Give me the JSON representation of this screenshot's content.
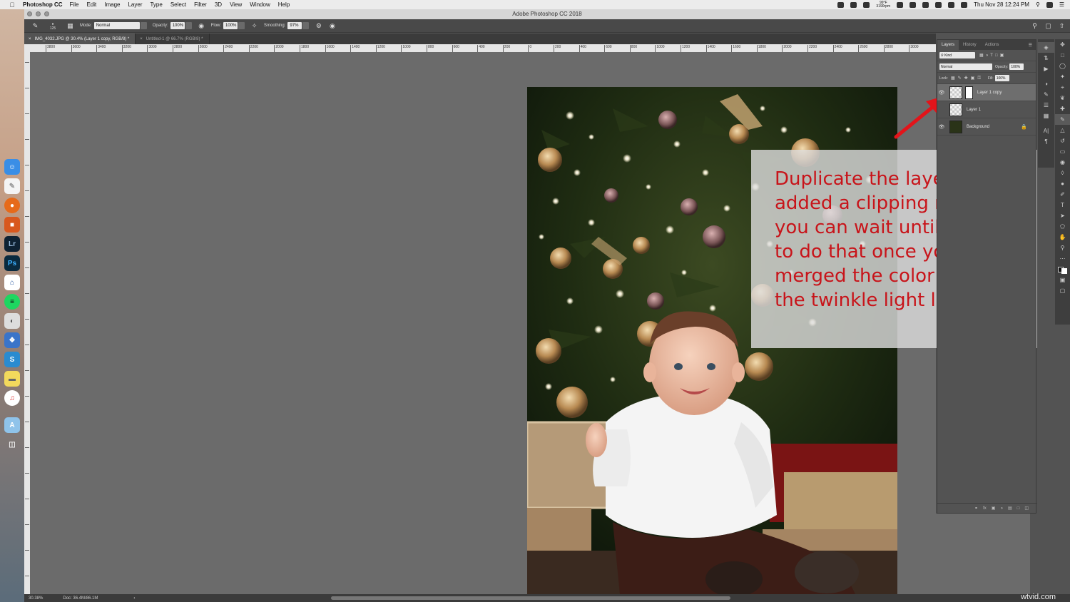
{
  "menubar": {
    "app_name": "Photoshop CC",
    "items": [
      "File",
      "Edit",
      "Image",
      "Layer",
      "Type",
      "Select",
      "Filter",
      "3D",
      "View",
      "Window",
      "Help"
    ],
    "window_title": "Adobe Photoshop CC 2018",
    "temperature": "99°F",
    "fan": "3190rpm",
    "clock": "Thu Nov 28  12:24 PM"
  },
  "options": {
    "brush_size": "125",
    "mode_label": "Mode:",
    "mode_value": "Normal",
    "opacity_label": "Opacity:",
    "opacity_value": "100%",
    "flow_label": "Flow:",
    "flow_value": "100%",
    "smoothing_label": "Smoothing:",
    "smoothing_value": "97%"
  },
  "tabs": [
    {
      "label": "IMG_4032.JPG @ 30.4% (Layer 1 copy, RGB/8) *"
    },
    {
      "label": "Untitled-1 @ 66.7% (RGB/8) *"
    }
  ],
  "ruler_labels": [
    "3800",
    "3600",
    "3400",
    "3200",
    "3000",
    "2800",
    "2600",
    "2400",
    "2200",
    "2000",
    "1800",
    "1600",
    "1400",
    "1200",
    "1000",
    "800",
    "600",
    "400",
    "200",
    "0",
    "200",
    "400",
    "600",
    "800",
    "1000",
    "1200",
    "1400",
    "1600",
    "1800",
    "2000",
    "2200",
    "2400",
    "2600",
    "2800",
    "3000"
  ],
  "callout": {
    "text": "Duplicate the layer. I’ve added a clipping mask but you can wait until the end to do that once you’ve merged the color layer with the twinkle light layer."
  },
  "layers_panel": {
    "tabs": [
      "Layers",
      "History",
      "Actions"
    ],
    "kind_label": "Kind",
    "blend_mode": "Normal",
    "opacity_label": "Opacity:",
    "opacity_value": "100%",
    "lock_label": "Lock:",
    "fill_label": "Fill:",
    "fill_value": "100%",
    "layers": [
      {
        "name": "Layer 1 copy"
      },
      {
        "name": "Layer 1"
      },
      {
        "name": "Background"
      }
    ],
    "footer_icons": [
      "link-icon",
      "fx-icon",
      "mask-icon",
      "adjustment-icon",
      "group-icon",
      "new-layer-icon",
      "trash-icon"
    ]
  },
  "status": {
    "zoom": "30.38%",
    "doc": "Doc: 36.4M/86.1M"
  },
  "watermark": "wtvid.com",
  "colors": {
    "accent_red": "#c8141a",
    "canvas": "#6b6b6b",
    "panel": "#535353"
  }
}
